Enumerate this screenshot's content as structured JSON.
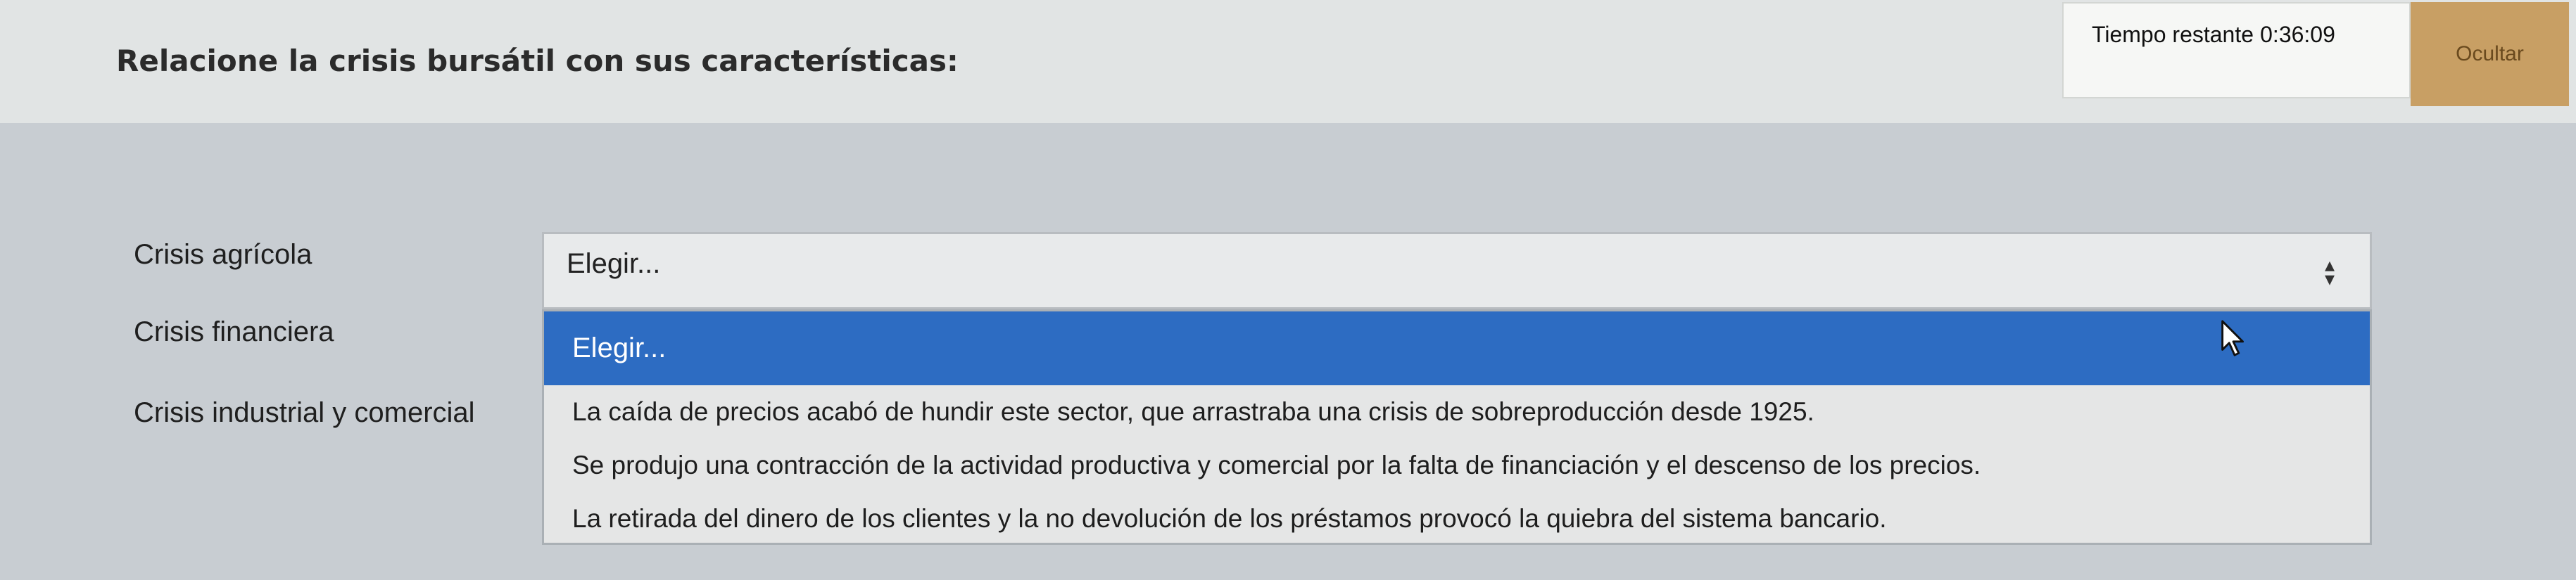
{
  "question": {
    "text": "Relacione la crisis bursátil con sus características:"
  },
  "timer": {
    "label": "Tiempo restante",
    "value": "0:36:09"
  },
  "toolbar": {
    "hide_label": "Ocultar"
  },
  "rows": [
    {
      "label": "Crisis agrícola"
    },
    {
      "label": "Crisis financiera"
    },
    {
      "label": "Crisis industrial y comercial"
    }
  ],
  "select": {
    "value": "Elegir...",
    "options": [
      "Elegir...",
      "La caída de precios acabó de hundir este sector, que arrastraba una crisis de sobreproducción desde 1925.",
      "Se produjo una contracción de la actividad productiva y comercial por la falta de financiación y el descenso de los precios.",
      "La retirada del dinero de los clientes y la no devolución de los préstamos provocó la quiebra del sistema bancario."
    ]
  },
  "colors": {
    "highlight": "#2d6cc2",
    "hide_button": "#c89f64"
  },
  "icons": {
    "select_arrow": "updown-arrows-icon",
    "cursor": "mouse-pointer-icon"
  }
}
